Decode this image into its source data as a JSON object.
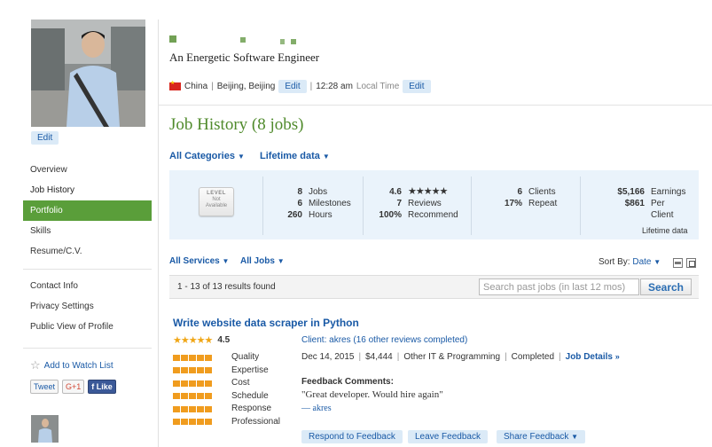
{
  "profile": {
    "tagline": "An Energetic Software Engineer",
    "country": "China",
    "city": "Beijing, Beijing",
    "time": "12:28 am",
    "time_label": "Local Time",
    "edit_label": "Edit"
  },
  "sidebar": {
    "edit_label": "Edit",
    "nav": [
      "Overview",
      "Job History",
      "Portfolio",
      "Skills",
      "Resume/C.V."
    ],
    "active_index": 2,
    "links": [
      "Contact Info",
      "Privacy Settings",
      "Public View of Profile"
    ],
    "watch_label": "Add to Watch List",
    "share": {
      "tweet": "Tweet",
      "gplus": "G+1",
      "like": "Like"
    }
  },
  "section": {
    "title": "Job History (8 jobs)",
    "filter_category": "All Categories",
    "filter_time": "Lifetime data"
  },
  "stats": {
    "level": {
      "l1": "LEVEL",
      "l2": "Not",
      "l3": "Available"
    },
    "jobs": "8",
    "jobs_label": "Jobs",
    "milestones": "6",
    "milestones_label": "Milestones",
    "hours": "260",
    "hours_label": "Hours",
    "rating": "4.6",
    "reviews": "7",
    "reviews_label": "Reviews",
    "recommend": "100%",
    "recommend_label": "Recommend",
    "clients": "6",
    "clients_label": "Clients",
    "repeat": "17%",
    "repeat_label": "Repeat",
    "earnings": "$5,166",
    "earnings_label": "Earnings",
    "per_client": "$861",
    "per_client_label1": "Per",
    "per_client_label2": "Client",
    "lifetime_note": "Lifetime data"
  },
  "jobs_toolbar": {
    "services": "All Services",
    "jobs": "All Jobs",
    "sort_label": "Sort By:",
    "sort_value": "Date",
    "results": "1 - 13 of 13 results found",
    "search_placeholder": "Search past jobs (in last 12 mos)",
    "search_button": "Search"
  },
  "job": {
    "title": "Write website data scraper in Python",
    "rating": "4.5",
    "criteria": [
      {
        "label": "Quality",
        "filled": 5
      },
      {
        "label": "Expertise",
        "filled": 5
      },
      {
        "label": "Cost",
        "filled": 5
      },
      {
        "label": "Schedule",
        "filled": 5
      },
      {
        "label": "Response",
        "filled": 5
      },
      {
        "label": "Professional",
        "filled": 5
      }
    ],
    "client_label": "Client:",
    "client_name": "akres",
    "client_reviews": "(16 other reviews completed)",
    "date": "Dec 14, 2015",
    "amount": "$4,444",
    "category": "Other IT & Programming",
    "status": "Completed",
    "details_label": "Job Details",
    "feedback_title": "Feedback Comments:",
    "feedback_text": "\"Great developer. Would hire again\"",
    "feedback_author": "— akres",
    "buttons": {
      "respond": "Respond to Feedback",
      "leave": "Leave Feedback",
      "share": "Share Feedback"
    }
  },
  "colors": {
    "accent_green": "#5a9e3a",
    "title_green": "#4f8a2b",
    "link_blue": "#1a5aa6",
    "star_orange": "#f0a616",
    "panel_blue": "#eaf3fb"
  }
}
